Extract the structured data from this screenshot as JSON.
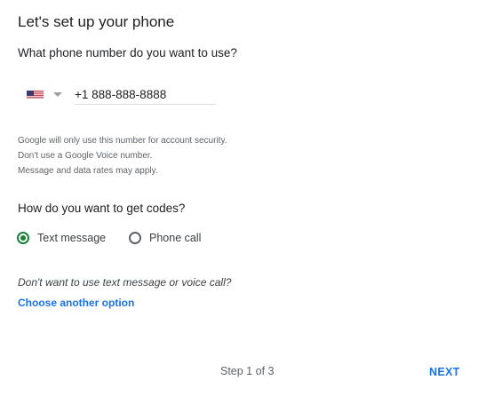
{
  "page": {
    "title": "Let's set up your phone"
  },
  "phone": {
    "question": "What phone number do you want to use?",
    "country_flag_icon": "us-flag-icon",
    "country_dropdown_icon": "chevron-down-icon",
    "value": "+1 888-888-8888"
  },
  "notes": [
    "Google will only use this number for account security.",
    "Don't use a Google Voice number.",
    "Message and data rates may apply."
  ],
  "codes": {
    "question": "How do you want to get codes?",
    "options": [
      {
        "label": "Text message",
        "selected": true
      },
      {
        "label": "Phone call",
        "selected": false
      }
    ]
  },
  "alternative": {
    "question": "Don't want to use text message or voice call?",
    "link_label": "Choose another option"
  },
  "footer": {
    "step_label": "Step 1 of 3",
    "next_label": "NEXT"
  },
  "colors": {
    "accent": "#1a73e8",
    "radio_selected": "#188038",
    "text_primary": "#202124",
    "text_secondary": "#5f6368"
  }
}
